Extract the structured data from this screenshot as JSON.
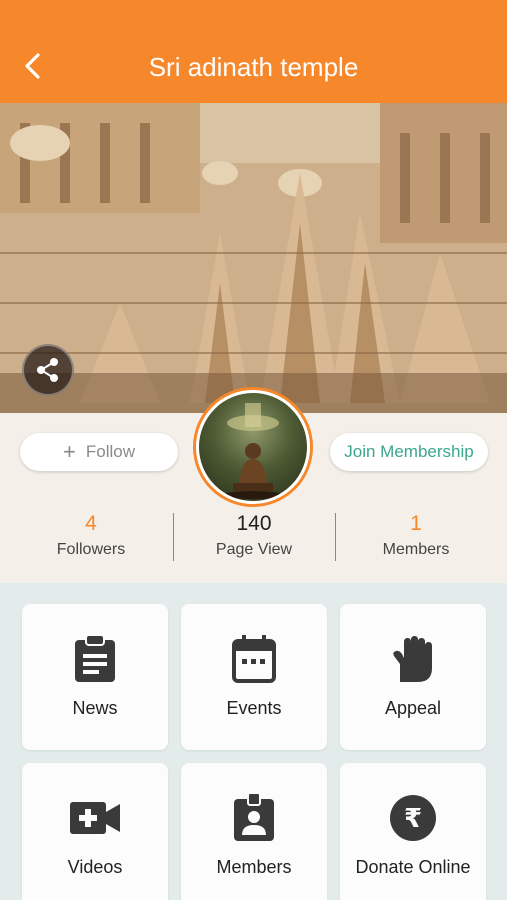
{
  "header": {
    "title": "Sri adinath temple",
    "back_icon": "back-arrow-icon"
  },
  "hero": {
    "share_icon": "share-icon"
  },
  "profile": {
    "follow_label": "Follow",
    "join_label": "Join Membership",
    "stats": [
      {
        "value": "4",
        "label": "Followers",
        "color": "#f6882b"
      },
      {
        "value": "140",
        "label": "Page View",
        "color": "#222222"
      },
      {
        "value": "1",
        "label": "Members",
        "color": "#f6882b"
      }
    ]
  },
  "menu": [
    {
      "label": "News",
      "icon": "clipboard-icon"
    },
    {
      "label": "Events",
      "icon": "calendar-icon"
    },
    {
      "label": "Appeal",
      "icon": "hand-icon"
    },
    {
      "label": "Videos",
      "icon": "video-add-icon"
    },
    {
      "label": "Members",
      "icon": "id-badge-icon"
    },
    {
      "label": "Donate Online",
      "icon": "rupee-icon"
    }
  ],
  "colors": {
    "accent": "#f6882b",
    "join": "#3aa68e",
    "icon": "#3a3a3a"
  }
}
